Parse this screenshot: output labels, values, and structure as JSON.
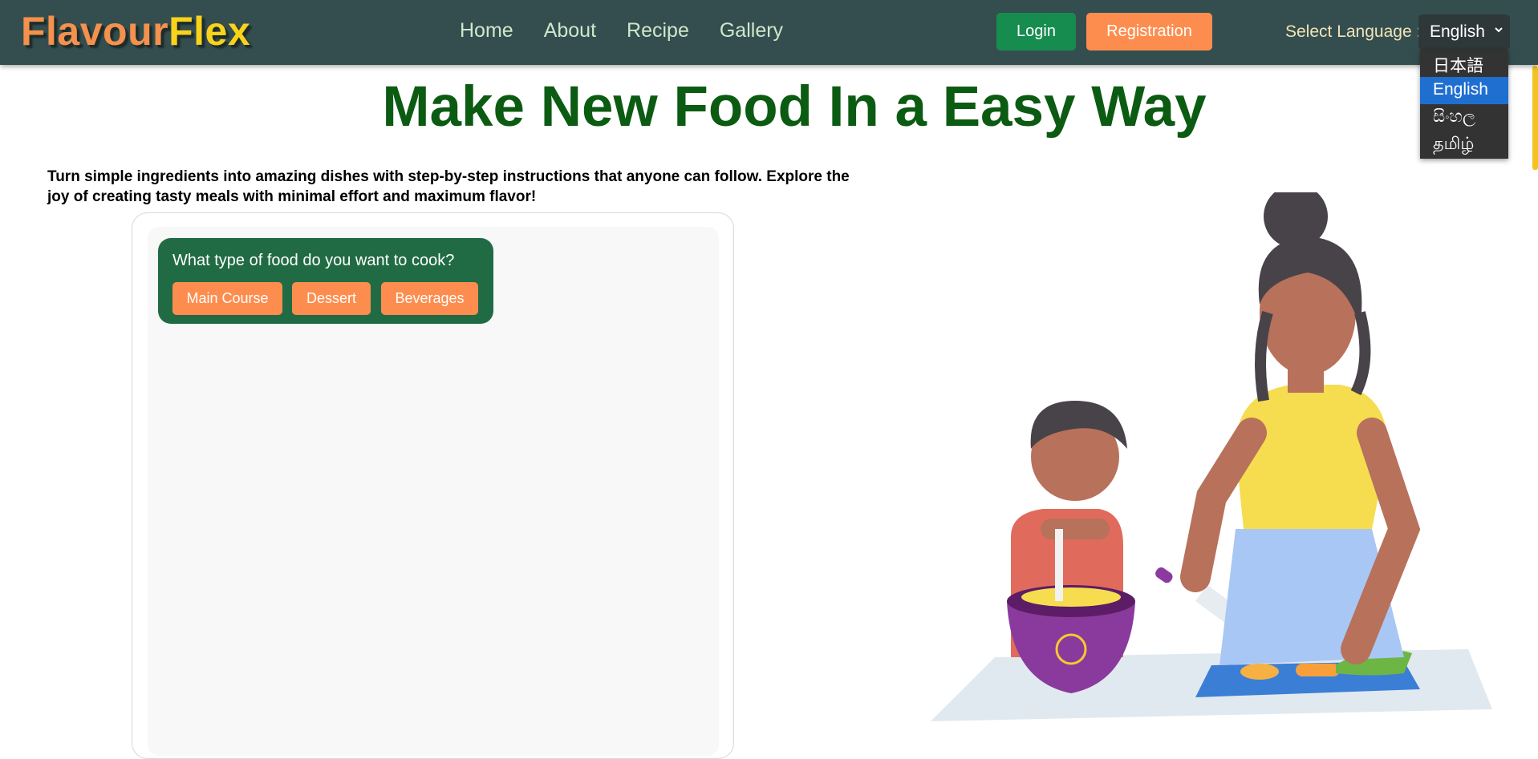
{
  "brand": {
    "part1": "Flavour",
    "part2": "Flex"
  },
  "nav": {
    "links": [
      "Home",
      "About",
      "Recipe",
      "Gallery"
    ]
  },
  "auth": {
    "login": "Login",
    "register": "Registration"
  },
  "language": {
    "label": "Select Language :",
    "selected": "English",
    "options": [
      "日本語",
      "English",
      "සිංහල",
      "தமிழ்"
    ]
  },
  "hero": {
    "title": "Make New Food In a Easy Way",
    "intro": "Turn simple ingredients into amazing dishes with step-by-step instructions that anyone can follow. Explore the joy of creating tasty meals with minimal effort and maximum flavor!"
  },
  "chat": {
    "question": "What type of food do you want to cook?",
    "options": [
      "Main Course",
      "Dessert",
      "Beverages"
    ]
  },
  "colors": {
    "navbar": "#344e4f",
    "brand_orange": "#f4914c",
    "brand_yellow": "#f9d21a",
    "title_green": "#0c5b12",
    "login_green": "#178c4f",
    "accent_orange": "#fd8d4f",
    "bubble_green": "#216b44"
  }
}
